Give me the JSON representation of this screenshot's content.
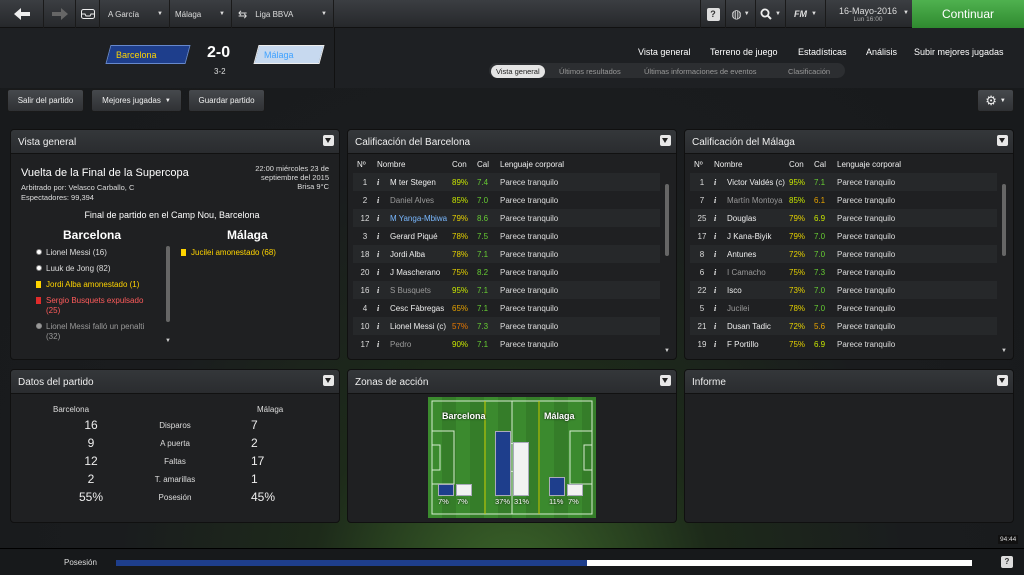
{
  "topbar": {
    "manager": "A García",
    "club": "Málaga",
    "competition": "Liga BBVA",
    "help": "?",
    "fm_logo": "FM",
    "date": "16-Mayo-2016",
    "weekday_time": "Lun 16:00",
    "continue_label": "Continuar"
  },
  "match": {
    "home": "Barcelona",
    "away": "Málaga",
    "score": "2-0",
    "aggregate": "3-2",
    "home_color": "#1e3e8c",
    "away_color": "#c7d9ef",
    "home_text_color": "#ffd400",
    "away_text_color": "#3fa2ff"
  },
  "nav": {
    "main": [
      "Vista general",
      "Terreno de juego",
      "Estadísticas",
      "Análisis",
      "Subir mejores jugadas"
    ],
    "sub": [
      "Vista general",
      "Últimos resultados",
      "Últimas informaciones de eventos",
      "Clasificación"
    ]
  },
  "toolbar": {
    "exit": "Salir del partido",
    "highlights": "Mejores jugadas",
    "save": "Guardar partido"
  },
  "overview": {
    "title": "Vista general",
    "competition": "Vuelta de la Final de la Supercopa",
    "referee": "Arbitrado por: Velasco Carballo, C",
    "attendance": "Espectadores: 99,394",
    "datetime_line1": "22:00 miércoles 23 de",
    "datetime_line2": "septiembre del 2015",
    "weather": "Brisa 9°C",
    "venue": "Final de partido en el Camp Nou, Barcelona",
    "home_team": "Barcelona",
    "away_team": "Málaga",
    "home_events": [
      {
        "icon": "ball",
        "text": "Lionel Messi (16)",
        "color": "#dddddd"
      },
      {
        "icon": "ball",
        "text": "Luuk de Jong (82)",
        "color": "#dddddd"
      },
      {
        "icon": "yellow",
        "text": "Jordi Alba amonestado (1)",
        "color": "#ffd400"
      },
      {
        "icon": "red",
        "text": "Sergio Busquets expulsado (25)",
        "color": "#ff5b5b"
      },
      {
        "icon": "missed",
        "text": "Lionel Messi falló un penalti (32)",
        "color": "#9a9a9a"
      }
    ],
    "away_events": [
      {
        "icon": "yellow",
        "text": "Jucilei amonestado (68)",
        "color": "#ffd400"
      }
    ]
  },
  "ratings_headers": [
    "Nº",
    "Nombre",
    "Con",
    "Cal",
    "Lenguaje corporal"
  ],
  "ratings_barcelona": {
    "title": "Calificación del Barcelona",
    "rows": [
      {
        "n": "1",
        "name": "M ter Stegen",
        "con": "89%",
        "cal": "7.4",
        "body": "Parece tranquilo",
        "name_color": "#eeeeee",
        "con_color": "#c8e600",
        "cal_color": "#66cc33"
      },
      {
        "n": "2",
        "name": "Daniel Alves",
        "con": "85%",
        "cal": "7.0",
        "body": "Parece tranquilo",
        "name_color": "#9a9a9a",
        "con_color": "#c8e600",
        "cal_color": "#66cc33"
      },
      {
        "n": "12",
        "name": "M Yanga-Mbiwa",
        "con": "79%",
        "cal": "8.6",
        "body": "Parece tranquilo",
        "name_color": "#79b8ff",
        "con_color": "#e6d200",
        "cal_color": "#66cc33"
      },
      {
        "n": "3",
        "name": "Gerard Piqué",
        "con": "78%",
        "cal": "7.5",
        "body": "Parece tranquilo",
        "name_color": "#eeeeee",
        "con_color": "#e6d200",
        "cal_color": "#66cc33"
      },
      {
        "n": "18",
        "name": "Jordi Alba",
        "con": "78%",
        "cal": "7.1",
        "body": "Parece tranquilo",
        "name_color": "#eeeeee",
        "con_color": "#e6d200",
        "cal_color": "#66cc33"
      },
      {
        "n": "20",
        "name": "J Mascherano",
        "con": "75%",
        "cal": "8.2",
        "body": "Parece tranquilo",
        "name_color": "#eeeeee",
        "con_color": "#e6d200",
        "cal_color": "#66cc33"
      },
      {
        "n": "16",
        "name": "S Busquets",
        "con": "95%",
        "cal": "7.1",
        "body": "Parece tranquilo",
        "name_color": "#9a9a9a",
        "con_color": "#c8e600",
        "cal_color": "#66cc33"
      },
      {
        "n": "4",
        "name": "Cesc Fàbregas",
        "con": "65%",
        "cal": "7.1",
        "body": "Parece tranquilo",
        "name_color": "#eeeeee",
        "con_color": "#e6a200",
        "cal_color": "#66cc33"
      },
      {
        "n": "10",
        "name": "Lionel Messi (c)",
        "con": "57%",
        "cal": "7.3",
        "body": "Parece tranquilo",
        "name_color": "#eeeeee",
        "con_color": "#e67700",
        "cal_color": "#66cc33"
      },
      {
        "n": "17",
        "name": "Pedro",
        "con": "90%",
        "cal": "7.1",
        "body": "Parece tranquilo",
        "name_color": "#9a9a9a",
        "con_color": "#c8e600",
        "cal_color": "#66cc33"
      }
    ]
  },
  "ratings_malaga": {
    "title": "Calificación del Málaga",
    "rows": [
      {
        "n": "1",
        "name": "Victor Valdés (c)",
        "con": "95%",
        "cal": "7.1",
        "body": "Parece tranquilo",
        "name_color": "#eeeeee",
        "con_color": "#c8e600",
        "cal_color": "#66cc33"
      },
      {
        "n": "7",
        "name": "Martín Montoya",
        "con": "85%",
        "cal": "6.1",
        "body": "Parece tranquilo",
        "name_color": "#9a9a9a",
        "con_color": "#c8e600",
        "cal_color": "#e6a200"
      },
      {
        "n": "25",
        "name": "Douglas",
        "con": "79%",
        "cal": "6.9",
        "body": "Parece tranquilo",
        "name_color": "#eeeeee",
        "con_color": "#e6d200",
        "cal_color": "#c8e600"
      },
      {
        "n": "17",
        "name": "J Kana-Biyik",
        "con": "79%",
        "cal": "7.0",
        "body": "Parece tranquilo",
        "name_color": "#eeeeee",
        "con_color": "#e6d200",
        "cal_color": "#66cc33"
      },
      {
        "n": "8",
        "name": "Antunes",
        "con": "72%",
        "cal": "7.0",
        "body": "Parece tranquilo",
        "name_color": "#eeeeee",
        "con_color": "#e6d200",
        "cal_color": "#66cc33"
      },
      {
        "n": "6",
        "name": "I Camacho",
        "con": "75%",
        "cal": "7.3",
        "body": "Parece tranquilo",
        "name_color": "#9a9a9a",
        "con_color": "#e6d200",
        "cal_color": "#66cc33"
      },
      {
        "n": "22",
        "name": "Isco",
        "con": "73%",
        "cal": "7.0",
        "body": "Parece tranquilo",
        "name_color": "#eeeeee",
        "con_color": "#e6d200",
        "cal_color": "#66cc33"
      },
      {
        "n": "5",
        "name": "Jucilei",
        "con": "78%",
        "cal": "7.0",
        "body": "Parece tranquilo",
        "name_color": "#9a9a9a",
        "con_color": "#e6d200",
        "cal_color": "#66cc33"
      },
      {
        "n": "21",
        "name": "Dusan Tadic",
        "con": "72%",
        "cal": "5.6",
        "body": "Parece tranquilo",
        "name_color": "#eeeeee",
        "con_color": "#e6d200",
        "cal_color": "#e6a200"
      },
      {
        "n": "19",
        "name": "F Portillo",
        "con": "75%",
        "cal": "6.9",
        "body": "Parece tranquilo",
        "name_color": "#eeeeee",
        "con_color": "#e6d200",
        "cal_color": "#c8e600"
      }
    ]
  },
  "stats": {
    "title": "Datos del partido",
    "home": "Barcelona",
    "away": "Málaga",
    "rows": [
      {
        "label": "Disparos",
        "home": "16",
        "away": "7"
      },
      {
        "label": "A puerta",
        "home": "9",
        "away": "2"
      },
      {
        "label": "Faltas",
        "home": "12",
        "away": "17"
      },
      {
        "label": "T. amarillas",
        "home": "2",
        "away": "1"
      },
      {
        "label": "Posesión",
        "home": "55%",
        "away": "45%"
      }
    ]
  },
  "zones": {
    "title": "Zonas de acción",
    "home": "Barcelona",
    "away": "Málaga",
    "values": [
      {
        "home": "7%",
        "away": "7%",
        "home_pct": 7,
        "away_pct": 7
      },
      {
        "home": "37%",
        "away": "31%",
        "home_pct": 37,
        "away_pct": 31
      },
      {
        "home": "11%",
        "away": "7%",
        "home_pct": 11,
        "away_pct": 7
      }
    ]
  },
  "report": {
    "title": "Informe"
  },
  "footer": {
    "possession_label": "Posesión",
    "clock": "94:44",
    "help": "?",
    "home_possession": 0.55
  }
}
